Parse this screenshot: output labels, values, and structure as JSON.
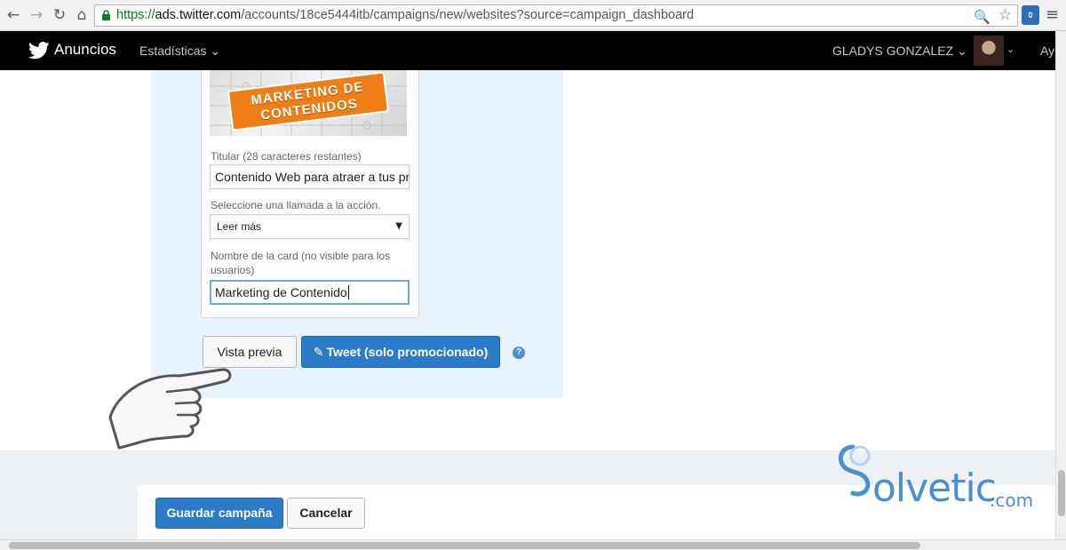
{
  "browser": {
    "url_scheme": "https://",
    "url_host": "ads.twitter.com",
    "url_path": "/accounts/18ce5444itb/campaigns/new/websites?source=campaign_dashboard",
    "icons": [
      "back-icon",
      "forward-icon",
      "reload-icon",
      "home-icon",
      "lock-icon",
      "zoom-icon",
      "star-icon",
      "extension-icon",
      "menu-icon"
    ]
  },
  "topnav": {
    "brand": "Anuncios",
    "stats_menu": "Estadísticas",
    "user_name": "GLADYS GONZALEZ",
    "help_cut": "Ay"
  },
  "card": {
    "image_text_line1": "MARKETING DE",
    "image_text_line2": "CONTENIDOS",
    "headline_label": "Titular (28 caracteres restantes)",
    "headline_value": "Contenido Web para atraer a tus pr",
    "cta_label": "Seleccione una llamada a la acción.",
    "cta_value": "Leer más",
    "name_label_line1": "Nombre de la card (no visible para los",
    "name_label_line2": "usuarios)",
    "name_value": "Marketing de Contenido"
  },
  "actions": {
    "preview": "Vista previa",
    "tweet": "Tweet (solo promocionado)",
    "help": "?"
  },
  "footer": {
    "save": "Guardar campaña",
    "cancel": "Cancelar"
  },
  "watermark": {
    "brand": "olvetic",
    "domain": ".com"
  },
  "colors": {
    "accent": "#2b7bc9",
    "nav_bg": "#000000",
    "panel_bg": "#e8f3fd",
    "image_orange": "#f07e16"
  }
}
